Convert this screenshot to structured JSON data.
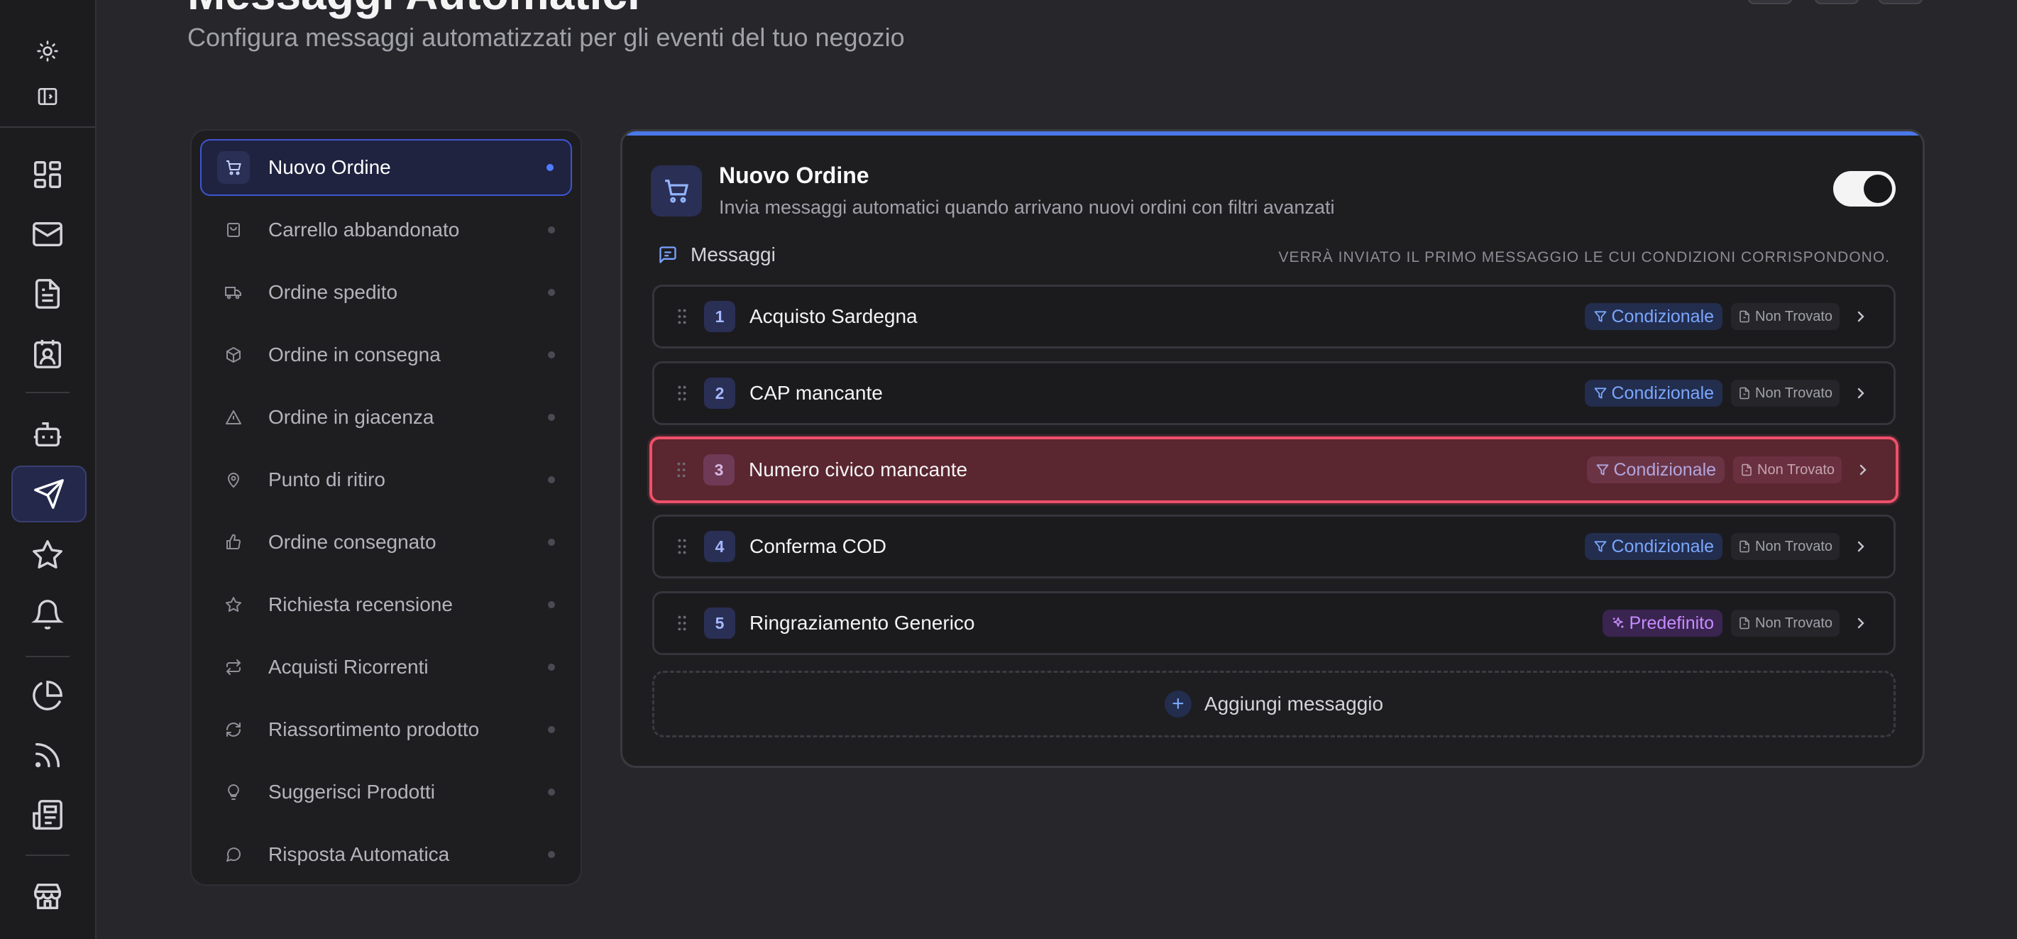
{
  "header": {
    "title": "Messaggi Automatici",
    "subtitle": "Configura messaggi automatizzati per gli eventi del tuo negozio"
  },
  "rail": {
    "items": [
      {
        "icon": "sun-icon"
      },
      {
        "icon": "sidebar-toggle-icon"
      },
      {
        "icon": "dashboard-icon"
      },
      {
        "icon": "mail-icon"
      },
      {
        "icon": "document-icon"
      },
      {
        "icon": "contacts-icon"
      },
      {
        "icon": "bot-icon"
      },
      {
        "icon": "send-icon",
        "active": true
      },
      {
        "icon": "star-icon"
      },
      {
        "icon": "bell-icon"
      },
      {
        "icon": "pie-chart-icon"
      },
      {
        "icon": "rss-icon"
      },
      {
        "icon": "newspaper-icon"
      },
      {
        "icon": "store-icon"
      }
    ]
  },
  "events": [
    {
      "label": "Nuovo Ordine",
      "icon": "cart-icon",
      "active": true
    },
    {
      "label": "Carrello abbandonato",
      "icon": "bag-icon"
    },
    {
      "label": "Ordine spedito",
      "icon": "truck-icon"
    },
    {
      "label": "Ordine in consegna",
      "icon": "package-icon"
    },
    {
      "label": "Ordine in giacenza",
      "icon": "warning-icon"
    },
    {
      "label": "Punto di ritiro",
      "icon": "map-pin-icon"
    },
    {
      "label": "Ordine consegnato",
      "icon": "thumbs-up-icon"
    },
    {
      "label": "Richiesta recensione",
      "icon": "star-icon"
    },
    {
      "label": "Acquisti Ricorrenti",
      "icon": "repeat-icon"
    },
    {
      "label": "Riassortimento prodotto",
      "icon": "refresh-icon"
    },
    {
      "label": "Suggerisci Prodotti",
      "icon": "lightbulb-icon"
    },
    {
      "label": "Risposta Automatica",
      "icon": "chat-icon"
    }
  ],
  "detail": {
    "title": "Nuovo Ordine",
    "description": "Invia messaggi automatici quando arrivano nuovi ordini con filtri avanzati",
    "enabled": true,
    "section_label": "Messaggi",
    "section_note": "VERRÀ INVIATO IL PRIMO MESSAGGIO LE CUI CONDIZIONI CORRISPONDONO.",
    "messages": [
      {
        "number": "1",
        "name": "Acquisto Sardegna",
        "badge": "Condizionale",
        "badge_type": "conditional",
        "status": "Non Trovato"
      },
      {
        "number": "2",
        "name": "CAP mancante",
        "badge": "Condizionale",
        "badge_type": "conditional",
        "status": "Non Trovato"
      },
      {
        "number": "3",
        "name": "Numero civico mancante",
        "badge": "Condizionale",
        "badge_type": "conditional",
        "status": "Non Trovato",
        "highlighted": true
      },
      {
        "number": "4",
        "name": "Conferma COD",
        "badge": "Condizionale",
        "badge_type": "conditional",
        "status": "Non Trovato"
      },
      {
        "number": "5",
        "name": "Ringraziamento Generico",
        "badge": "Predefinito",
        "badge_type": "default",
        "status": "Non Trovato"
      }
    ],
    "add_label": "Aggiungi messaggio"
  },
  "colors": {
    "accent": "#4a78e8",
    "highlight_border": "#f05068",
    "conditional": "#7aa7ff",
    "default": "#c68cff"
  }
}
